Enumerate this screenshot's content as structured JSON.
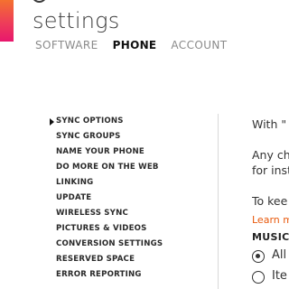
{
  "app": {
    "title": "settings"
  },
  "tabs": [
    {
      "label": "SOFTWARE",
      "active": false
    },
    {
      "label": "PHONE",
      "active": true
    },
    {
      "label": "ACCOUNT",
      "active": false
    }
  ],
  "nav": {
    "items": [
      {
        "label": "SYNC OPTIONS",
        "selected": true
      },
      {
        "label": "SYNC GROUPS"
      },
      {
        "label": "NAME YOUR PHONE"
      },
      {
        "label": "DO MORE ON THE WEB"
      },
      {
        "label": "LINKING"
      },
      {
        "label": "UPDATE"
      },
      {
        "label": "WIRELESS SYNC"
      },
      {
        "label": "PICTURES & VIDEOS"
      },
      {
        "label": "CONVERSION SETTINGS"
      },
      {
        "label": "RESERVED SPACE"
      },
      {
        "label": "ERROR REPORTING"
      }
    ]
  },
  "content": {
    "intro_line": "With \"",
    "para1_line1": "Any ch",
    "para1_line2": "for inst",
    "para2_line1": "To kee",
    "learn_more": "Learn m",
    "music_heading": "MUSIC",
    "radio_all_label": "All",
    "radio_items_label": "Ite"
  },
  "colors": {
    "accent_top": "#f4712f",
    "accent_bottom": "#e8176d",
    "link": "#e8590c"
  },
  "icons": {
    "back": "back-arrow-icon",
    "selected_marker": "triangle-right-icon"
  }
}
